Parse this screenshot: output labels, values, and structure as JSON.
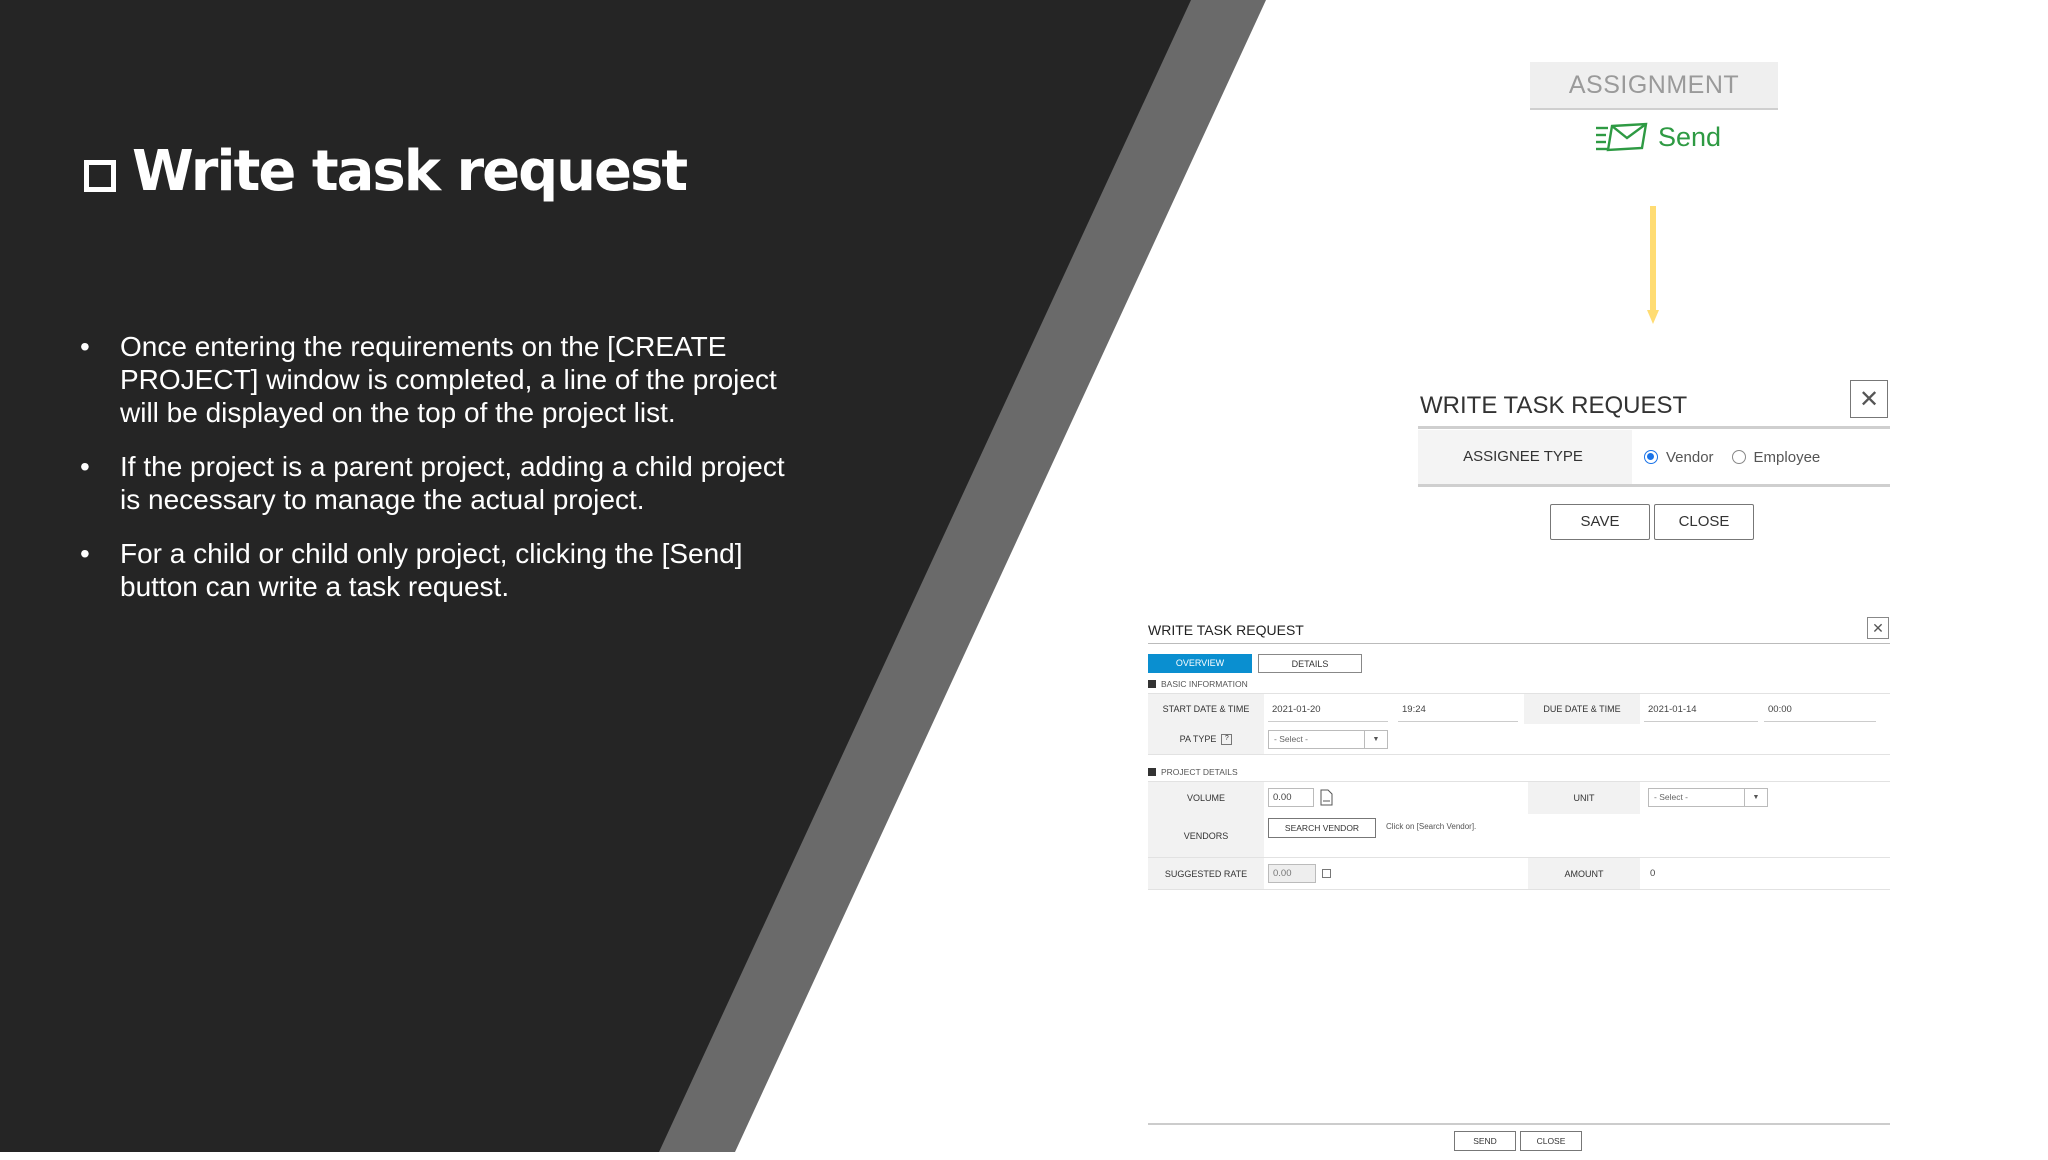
{
  "slide": {
    "title": "Write task request",
    "bullets": [
      "Once entering the requirements on the [CREATE PROJECT] window is completed, a line of the project will be displayed on the top of the project list.",
      "If the project is a parent project, adding a child project is necessary to manage the actual project.",
      "For a child or child only project, clicking the [Send] button can write a task request."
    ]
  },
  "assignment": {
    "header": "ASSIGNMENT",
    "send_label": "Send"
  },
  "dialog_assign": {
    "title": "WRITE TASK REQUEST",
    "assignee_label": "ASSIGNEE TYPE",
    "options": [
      "Vendor",
      "Employee"
    ],
    "selected": "Vendor",
    "save": "SAVE",
    "close": "CLOSE"
  },
  "dialog_task": {
    "title": "WRITE TASK REQUEST",
    "tabs": [
      "OVERVIEW",
      "DETAILS"
    ],
    "basic_info": "BASIC INFORMATION",
    "start_label": "START DATE & TIME",
    "start_date": "2021-01-20",
    "start_time": "19:24",
    "due_label": "DUE DATE & TIME",
    "due_date": "2021-01-14",
    "due_time": "00:00",
    "pa_type_label": "PA TYPE",
    "pa_help": "?",
    "select_placeholder": "- Select -",
    "project_details": "PROJECT DETAILS",
    "volume_label": "VOLUME",
    "volume_value": "0.00",
    "unit_label": "UNIT",
    "vendors_label": "VENDORS",
    "search_vendor": "SEARCH VENDOR",
    "vendor_hint": "Click on [Search Vendor].",
    "suggested_rate_label": "SUGGESTED RATE",
    "suggested_rate": "0.00",
    "amount_label": "AMOUNT",
    "amount": "0",
    "send": "SEND",
    "close": "CLOSE"
  },
  "colors": {
    "dark_panel": "#252525",
    "stripe": "#6a6a6a",
    "send_green": "#2e9a43",
    "arrow": "#ffdc73",
    "tab_active": "#0a8fd0"
  }
}
